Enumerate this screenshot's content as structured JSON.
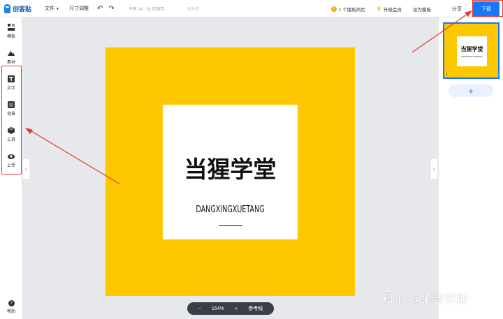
{
  "app": {
    "logo_text": "创客贴"
  },
  "topbar": {
    "file_label": "文件",
    "resize_label": "尺寸调整",
    "saved_text": "今天 14 : 15 已保存",
    "draft_text": "未命名",
    "risk_label": "1 个版权风险",
    "vip_label": "升级会员",
    "set_template_label": "设为模板",
    "share_label": "分享",
    "download_label": "下载"
  },
  "sidebar": {
    "items": [
      {
        "label": "模板",
        "icon": "template-icon"
      },
      {
        "label": "素材",
        "icon": "material-icon"
      },
      {
        "label": "文字",
        "icon": "text-icon"
      },
      {
        "label": "背景",
        "icon": "background-icon"
      },
      {
        "label": "工具",
        "icon": "tools-icon"
      },
      {
        "label": "上传",
        "icon": "upload-icon"
      }
    ],
    "help_label": "帮助"
  },
  "canvas": {
    "title": "当猩学堂",
    "subtitle": "DANGXINGXUETANG",
    "bg_color": "#fec800",
    "card_color": "#ffffff"
  },
  "zoom": {
    "minus": "−",
    "value": "154%",
    "plus": "+",
    "guides_label": "参考线"
  },
  "pages": {
    "thumb_title": "当猩学堂",
    "thumb_subtitle": "DANGXINGXUETANG",
    "page_number": "1",
    "add_label": "+"
  },
  "watermark": "知乎 @果吉尔斯",
  "colors": {
    "accent": "#1677ff",
    "highlight": "#e53935"
  }
}
